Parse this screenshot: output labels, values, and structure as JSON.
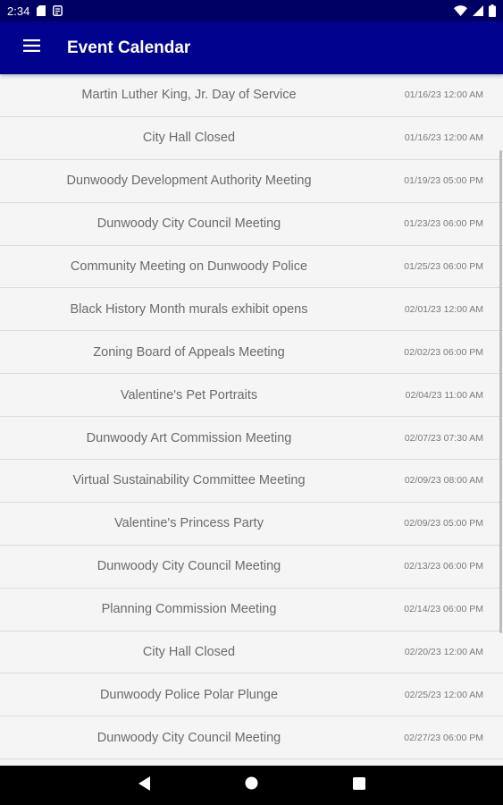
{
  "status_bar": {
    "time": "2:34",
    "icons": [
      "sd-card-icon",
      "notification-icon",
      "wifi-icon",
      "signal-icon",
      "battery-icon"
    ]
  },
  "app_bar": {
    "title": "Event Calendar",
    "menu_icon": "hamburger-menu-icon",
    "background": "#01038f"
  },
  "events": [
    {
      "title": "Martin Luther King, Jr. Day of Service",
      "date": "01/16/23 12:00 AM"
    },
    {
      "title": "City Hall Closed",
      "date": "01/16/23 12:00 AM"
    },
    {
      "title": "Dunwoody Development Authority Meeting",
      "date": "01/19/23 05:00 PM"
    },
    {
      "title": "Dunwoody City Council Meeting",
      "date": "01/23/23 06:00 PM"
    },
    {
      "title": "Community Meeting on Dunwoody Police",
      "date": "01/25/23 06:00 PM"
    },
    {
      "title": "Black History Month murals exhibit opens",
      "date": "02/01/23 12:00 AM"
    },
    {
      "title": "Zoning Board of Appeals Meeting",
      "date": "02/02/23 06:00 PM"
    },
    {
      "title": "Valentine's Pet Portraits",
      "date": "02/04/23 11:00 AM"
    },
    {
      "title": "Dunwoody Art Commission Meeting",
      "date": "02/07/23 07:30 AM"
    },
    {
      "title": "Virtual Sustainability Committee Meeting",
      "date": "02/09/23 08:00 AM"
    },
    {
      "title": "Valentine's Princess Party",
      "date": "02/09/23 05:00 PM"
    },
    {
      "title": "Dunwoody City Council Meeting",
      "date": "02/13/23 06:00 PM"
    },
    {
      "title": "Planning Commission Meeting",
      "date": "02/14/23 06:00 PM"
    },
    {
      "title": "City Hall Closed",
      "date": "02/20/23 12:00 AM"
    },
    {
      "title": "Dunwoody Police Polar Plunge",
      "date": "02/25/23 12:00 AM"
    },
    {
      "title": "Dunwoody City Council Meeting",
      "date": "02/27/23 06:00 PM"
    }
  ],
  "nav_bar": {
    "buttons": [
      "back-icon",
      "home-icon",
      "recents-icon"
    ]
  }
}
